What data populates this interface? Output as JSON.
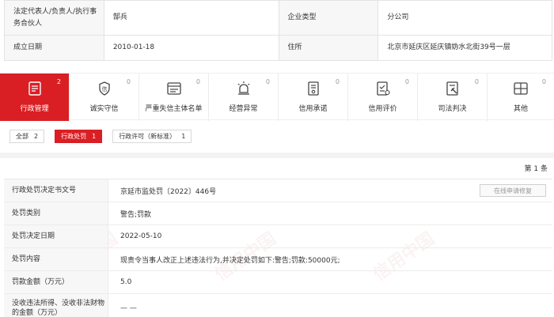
{
  "info": {
    "row1": {
      "label1": "法定代表人/负责人/执行事务合伙人",
      "value1": "郜兵",
      "label2": "企业类型",
      "value2": "分公司"
    },
    "row2": {
      "label1": "成立日期",
      "value1": "2010-01-18",
      "label2": "住所",
      "value2": "北京市延庆区延庆镇妫水北街39号一层"
    }
  },
  "categories": [
    {
      "label": "行政管理",
      "count": "2",
      "icon": "document-icon"
    },
    {
      "label": "诚实守信",
      "count": "0",
      "icon": "shield-icon"
    },
    {
      "label": "严重失信主体名单",
      "count": "0",
      "icon": "blacklist-icon"
    },
    {
      "label": "经营异常",
      "count": "0",
      "icon": "alarm-icon"
    },
    {
      "label": "信用承诺",
      "count": "0",
      "icon": "promise-icon"
    },
    {
      "label": "信用评价",
      "count": "0",
      "icon": "evaluation-icon"
    },
    {
      "label": "司法判决",
      "count": "0",
      "icon": "judgment-icon"
    },
    {
      "label": "其他",
      "count": "0",
      "icon": "other-icon"
    }
  ],
  "filters": [
    {
      "label": "全部",
      "count": "2"
    },
    {
      "label": "行政处罚",
      "count": "1"
    },
    {
      "label": "行政许可（新标准）",
      "count": "1"
    }
  ],
  "page_count": "第 1 条",
  "repair_button": "在线申请修复",
  "detail": [
    {
      "label": "行政处罚决定书文号",
      "value": "京延市监处罚〔2022〕446号"
    },
    {
      "label": "处罚类别",
      "value": "警告;罚款"
    },
    {
      "label": "处罚决定日期",
      "value": "2022-05-10"
    },
    {
      "label": "处罚内容",
      "value": "现责令当事人改正上述违法行为,并决定处罚如下:警告;罚款:50000元;"
    },
    {
      "label": "罚款金额（万元）",
      "value": "5.0"
    },
    {
      "label": "没收违法所得、没收非法财物的金额（万元）",
      "value": "— —"
    }
  ],
  "watermark": "信用中国",
  "colors": {
    "accent": "#d91f24"
  }
}
